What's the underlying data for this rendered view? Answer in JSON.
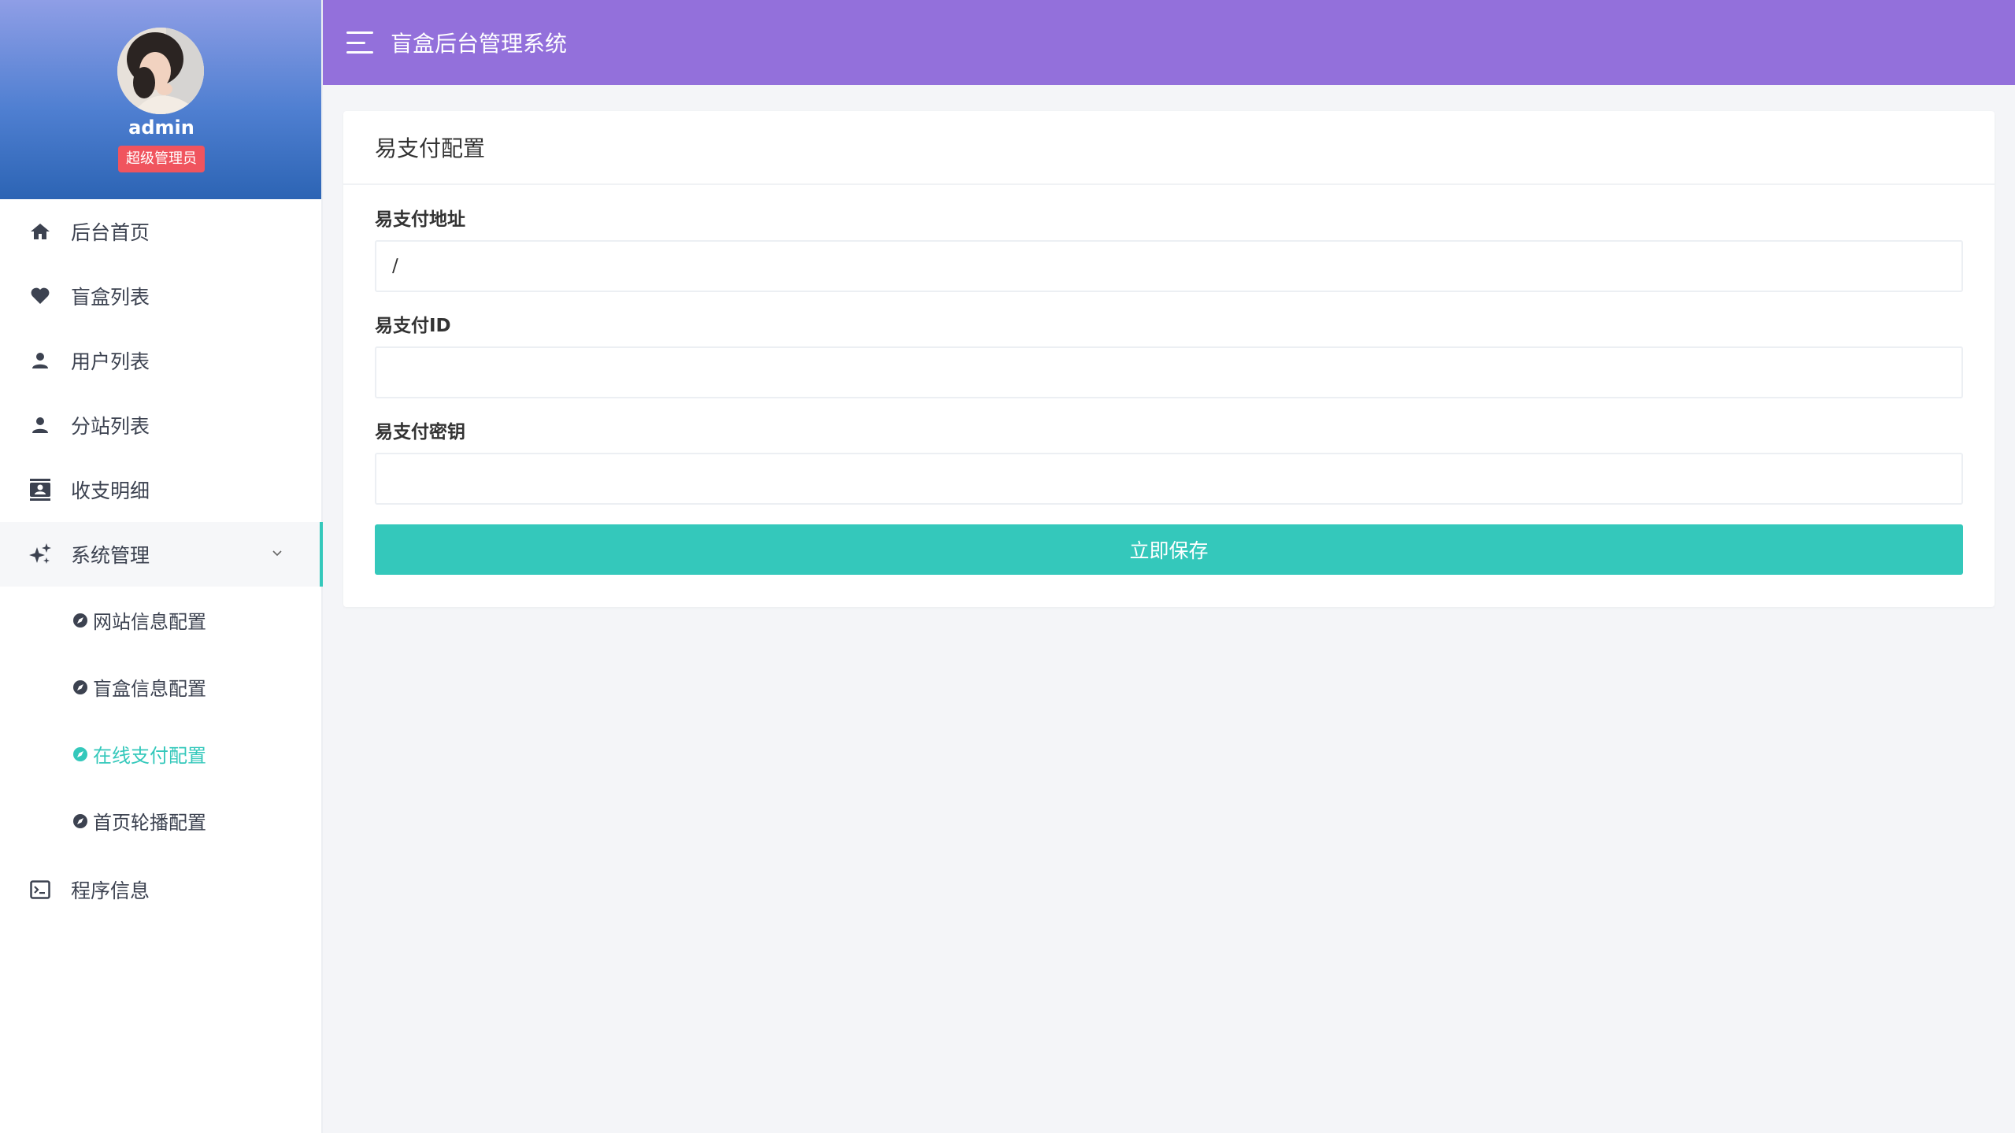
{
  "app": {
    "title": "盲盒后台管理系统"
  },
  "profile": {
    "username": "admin",
    "role": "超级管理员"
  },
  "sidebar": {
    "items": [
      {
        "label": "后台首页",
        "icon": "home-icon"
      },
      {
        "label": "盲盒列表",
        "icon": "heart-icon"
      },
      {
        "label": "用户列表",
        "icon": "user-icon"
      },
      {
        "label": "分站列表",
        "icon": "user-icon"
      },
      {
        "label": "收支明细",
        "icon": "contacts-icon"
      },
      {
        "label": "系统管理",
        "icon": "sparkle-icon",
        "expanded": true,
        "children": [
          {
            "label": "网站信息配置",
            "icon": "compass-icon"
          },
          {
            "label": "盲盒信息配置",
            "icon": "compass-icon"
          },
          {
            "label": "在线支付配置",
            "icon": "compass-icon",
            "active": true
          },
          {
            "label": "首页轮播配置",
            "icon": "compass-icon"
          }
        ]
      },
      {
        "label": "程序信息",
        "icon": "terminal-icon"
      }
    ]
  },
  "card": {
    "title": "易支付配置",
    "fields": [
      {
        "label": "易支付地址",
        "value": "/"
      },
      {
        "label": "易支付ID",
        "value": ""
      },
      {
        "label": "易支付密钥",
        "value": ""
      }
    ],
    "save_label": "立即保存"
  },
  "colors": {
    "header_bg": "#9370db",
    "accent": "#34c8bb",
    "badge": "#f0545e",
    "page_bg": "#f4f5f8"
  }
}
